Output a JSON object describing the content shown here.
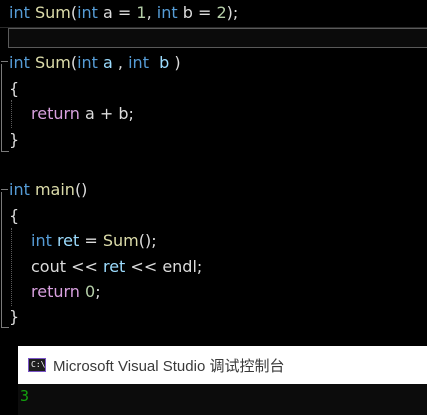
{
  "editor": {
    "line1": {
      "kw_int_1": "int",
      "fn_sum": "Sum",
      "p1": "(",
      "kw_int_2": "int",
      "a_default": " a = ",
      "one": "1",
      "comma": ", ",
      "kw_int_3": "int",
      "b_default": " b = ",
      "two": "2",
      "end": ");"
    },
    "line2": {
      "kw_int_1": "int",
      "fn_sum": "Sum",
      "p1": "(",
      "kw_int_2": "int",
      "var_a": " a",
      "comma": " , ",
      "kw_int_3": "int",
      "var_b": "  b",
      "end": " )"
    },
    "brace_open_1": "{",
    "line_return_sum": {
      "kw_return": "return",
      "expr": " a + b;"
    },
    "brace_close_1": "}",
    "line_main": {
      "kw_int": "int",
      "fn_main": "main",
      "end": "()"
    },
    "brace_open_2": "{",
    "line_ret": {
      "kw_int": "int",
      "var_ret": " ret",
      "eq": " = ",
      "fn_sum": "Sum",
      "end": "();"
    },
    "line_cout": {
      "cout": "cout",
      "op1": " << ",
      "var_ret": "ret",
      "op2": " << ",
      "endl": "endl",
      "end": ";"
    },
    "line_return0": {
      "kw_return": "return",
      "space": " ",
      "zero": "0",
      "end": ";"
    },
    "brace_close_2": "}"
  },
  "console": {
    "icon_text": "C:\\",
    "title": "Microsoft Visual Studio 调试控制台",
    "output": "3"
  },
  "colors": {
    "keyword": "#569cd6",
    "function": "#dcdcaa",
    "control": "#d8a0df",
    "variable": "#9cdcfe",
    "number": "#b5cea8",
    "text": "#dcdcdc",
    "console_output": "#13a10e"
  }
}
